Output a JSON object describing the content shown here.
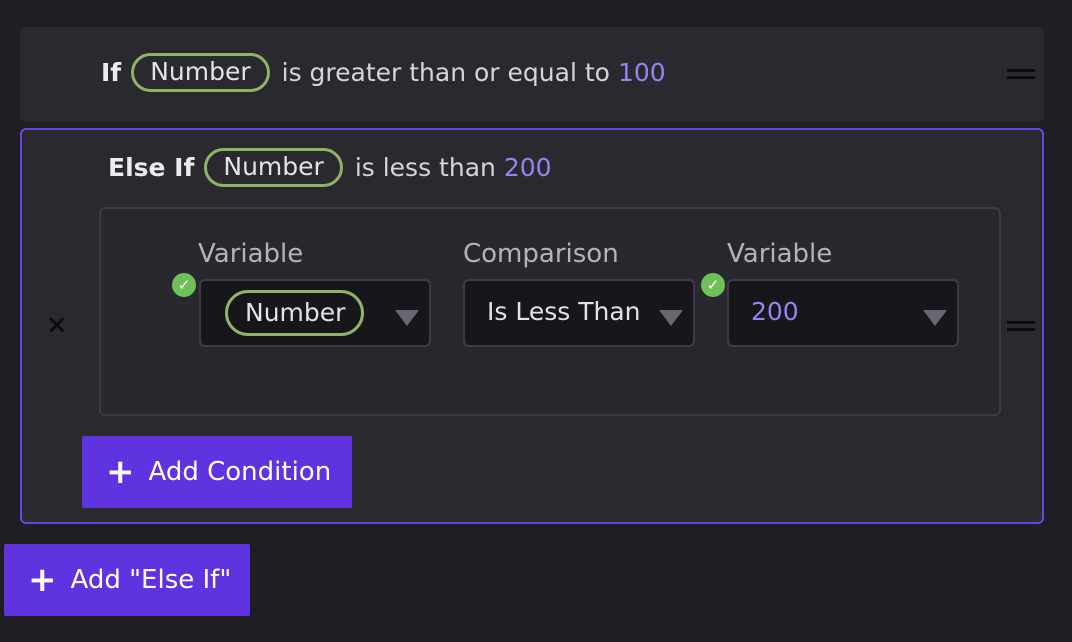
{
  "if_block": {
    "keyword": "If",
    "variable": "Number",
    "operator_text": "is greater than or equal to",
    "value": "100"
  },
  "elseif_block": {
    "keyword": "Else If",
    "variable": "Number",
    "operator_text": "is less than",
    "value": "200",
    "remove_icon": "×",
    "condition": {
      "left_label": "Variable",
      "left_value": "Number",
      "comparison_label": "Comparison",
      "comparison_value": "Is Less Than",
      "right_label": "Variable",
      "right_value": "200"
    },
    "add_condition_label": "Add Condition"
  },
  "add_elseif_label": "Add \"Else If\"",
  "icons": {
    "plus": "+",
    "check": "✓",
    "drag": "drag-handle-icon"
  },
  "colors": {
    "accent": "#5f33e0",
    "border_active": "#6b44e3",
    "pill": "#8fb466",
    "number": "#9a82ee",
    "valid": "#6fbf5a"
  }
}
